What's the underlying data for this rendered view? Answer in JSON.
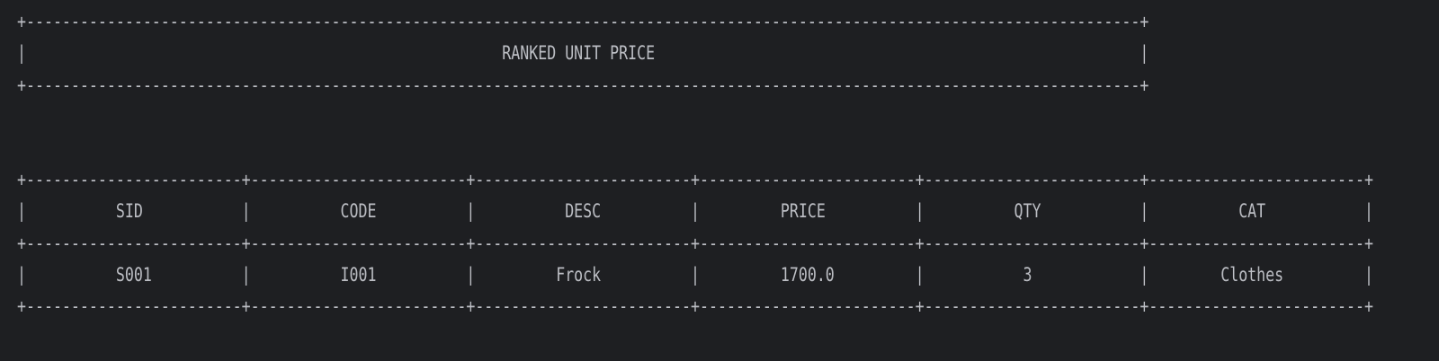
{
  "banner": {
    "title": "RANKED UNIT PRICE",
    "width": 124
  },
  "table": {
    "col_width": 25,
    "headers": [
      "SID",
      "CODE",
      "DESC",
      "PRICE",
      "QTY",
      "CAT"
    ],
    "rows": [
      [
        "S001",
        "I001",
        "Frock",
        "1700.0",
        "3",
        "Clothes"
      ]
    ]
  }
}
